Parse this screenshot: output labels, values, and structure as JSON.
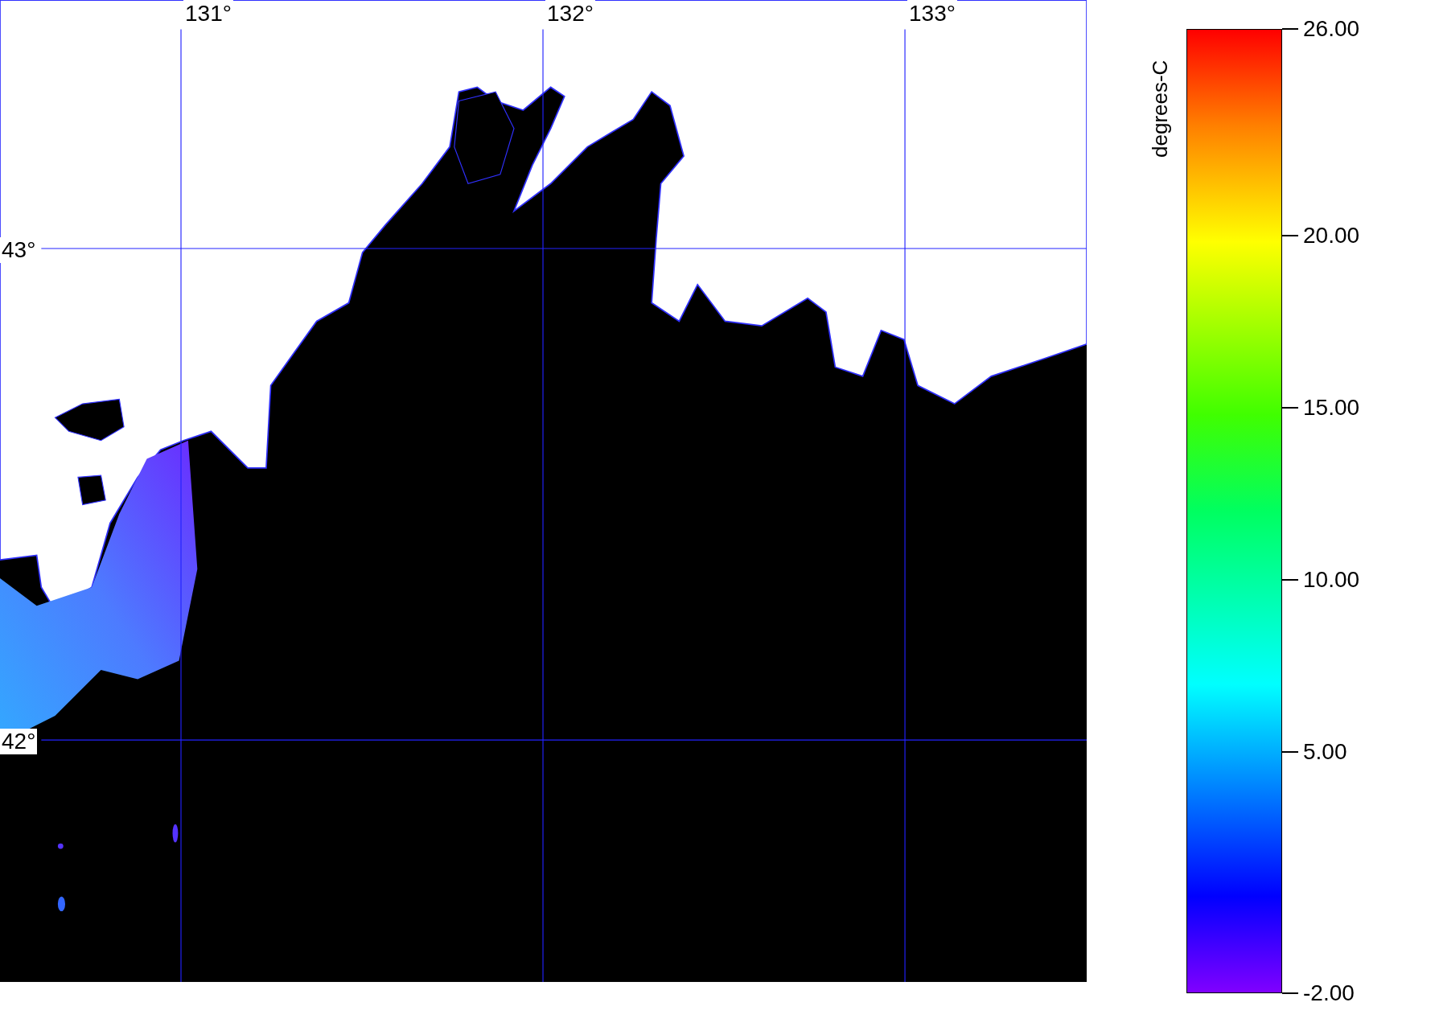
{
  "map": {
    "longitude_labels": [
      "131°",
      "132°",
      "133°"
    ],
    "latitude_labels": [
      "43°",
      "42°"
    ]
  },
  "colorbar": {
    "title": "degrees-C",
    "ticks": [
      "26.00",
      "20.00",
      "15.00",
      "10.00",
      "5.00",
      "-2.00"
    ]
  }
}
